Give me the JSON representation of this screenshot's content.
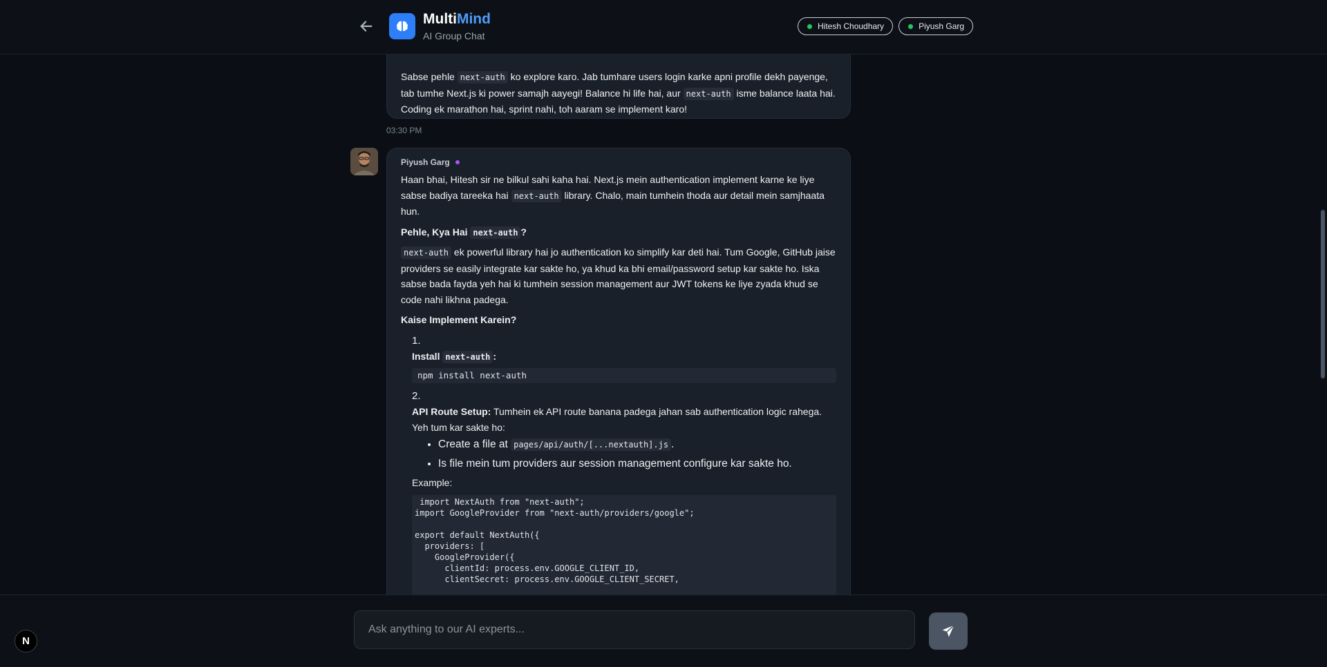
{
  "header": {
    "brand_main": "Multi",
    "brand_accent": "Mind",
    "subtitle": "AI Group Chat",
    "participants": [
      "Hitesh Choudhary",
      "Piyush Garg"
    ]
  },
  "messages": {
    "m1": {
      "paragraph": [
        "Sabse pehle ",
        "next-auth",
        " ko explore karo. Jab tumhare users login karke apni profile dekh payenge, tab tumhe Next.js ki power samajh aayegi! Balance hi life hai, aur ",
        "next-auth",
        " isme balance laata hai. Coding ek marathon hai, sprint nahi, toh aaram se implement karo!"
      ],
      "timestamp": "03:30 PM"
    },
    "m2": {
      "sender": "Piyush Garg",
      "intro": [
        "Haan bhai, Hitesh sir ne bilkul sahi kaha hai. Next.js mein authentication implement karne ke liye sabse badiya tareeka hai ",
        "next-auth",
        " library. Chalo, main tumhein thoda aur detail mein samjhaata hun."
      ],
      "heading1": [
        "Pehle, Kya Hai ",
        "next-auth",
        "?"
      ],
      "para2": [
        "next-auth",
        " ek powerful library hai jo authentication ko simplify kar deti hai. Tum Google, GitHub jaise providers se easily integrate kar sakte ho, ya khud ka bhi email/password setup kar sakte ho. Iska sabse bada fayda yeh hai ki tumhein session management aur JWT tokens ke liye zyada khud se code nahi likhna padega."
      ],
      "heading2": "Kaise Implement Karein?",
      "step1_num": "1.",
      "step1": [
        "Install ",
        "next-auth",
        ":"
      ],
      "step1_code": "npm install next-auth",
      "step2_num": "2.",
      "step2_bold": "API Route Setup:",
      "step2_text": " Tumhein ek API route banana padega jahan sab authentication logic rahega. Yeh tum kar sakte ho:",
      "bullets": [
        [
          "Create a file at ",
          "pages/api/auth/[...nextauth].js",
          "."
        ],
        [
          "Is file mein tum providers aur session management configure kar sakte ho."
        ]
      ],
      "example_label": "Example:",
      "code_lines": [
        " import NextAuth from \"next-auth\";",
        "import GoogleProvider from \"next-auth/providers/google\";",
        "",
        "export default NextAuth({",
        "  providers: [",
        "    GoogleProvider({",
        "      clientId: process.env.GOOGLE_CLIENT_ID,",
        "      clientSecret: process.env.GOOGLE_CLIENT_SECRET,"
      ]
    }
  },
  "composer": {
    "placeholder": "Ask anything to our AI experts..."
  },
  "badge": {
    "letter": "N"
  },
  "colors": {
    "accent": "#4f9cf9",
    "online": "#22c55e",
    "sender_dot": "#a855f7"
  },
  "icons": [
    "arrow-left-icon",
    "brain-icon",
    "send-icon",
    "nextjs-icon"
  ]
}
